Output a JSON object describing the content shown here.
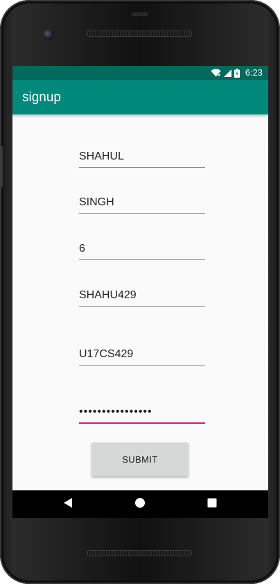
{
  "status_bar": {
    "time": "6:23",
    "icons": [
      "wifi-icon",
      "signal-icon",
      "battery-icon"
    ]
  },
  "app_bar": {
    "title": "signup"
  },
  "form": {
    "first_name": "SHAHUL",
    "last_name": "SINGH",
    "number": "6",
    "username": "SHAHU429",
    "roll_number": "U17CS429",
    "password": "••••••••••••••••"
  },
  "submit": {
    "label": "SUBMIT"
  },
  "nav_bar": {
    "icons": [
      "back-icon",
      "home-icon",
      "recents-icon"
    ]
  },
  "colors": {
    "status_bar": "#00695c",
    "app_bar": "#00897b",
    "accent": "#d81b60",
    "button": "#d6d7d7"
  }
}
